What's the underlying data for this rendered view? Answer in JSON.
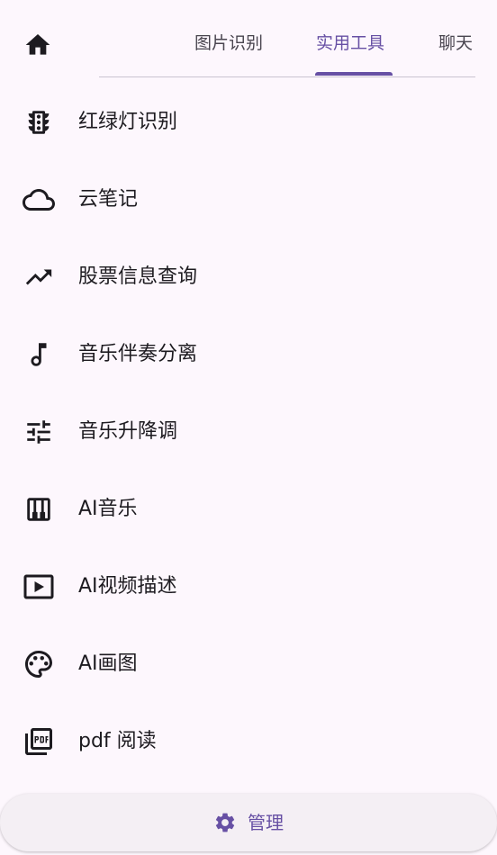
{
  "header": {
    "home_icon": "home-icon",
    "tabs": [
      {
        "label": "图片识别",
        "active": false
      },
      {
        "label": "实用工具",
        "active": true
      },
      {
        "label": "聊天",
        "active": false
      }
    ]
  },
  "items": [
    {
      "label": "红绿灯识别",
      "icon": "traffic-light-icon"
    },
    {
      "label": "云笔记",
      "icon": "cloud-icon"
    },
    {
      "label": "股票信息查询",
      "icon": "trending-up-icon"
    },
    {
      "label": "音乐伴奏分离",
      "icon": "music-note-icon"
    },
    {
      "label": "音乐升降调",
      "icon": "tune-icon"
    },
    {
      "label": "AI音乐",
      "icon": "piano-icon"
    },
    {
      "label": "AI视频描述",
      "icon": "video-play-icon"
    },
    {
      "label": "AI画图",
      "icon": "palette-icon"
    },
    {
      "label": "pdf 阅读",
      "icon": "pdf-icon"
    }
  ],
  "bottom": {
    "label": "管理",
    "icon": "gear-icon"
  },
  "colors": {
    "background": "#fdf7fd",
    "accent": "#6750a4",
    "icon": "#1d1b20",
    "bottom_bar": "#f4eff4"
  }
}
